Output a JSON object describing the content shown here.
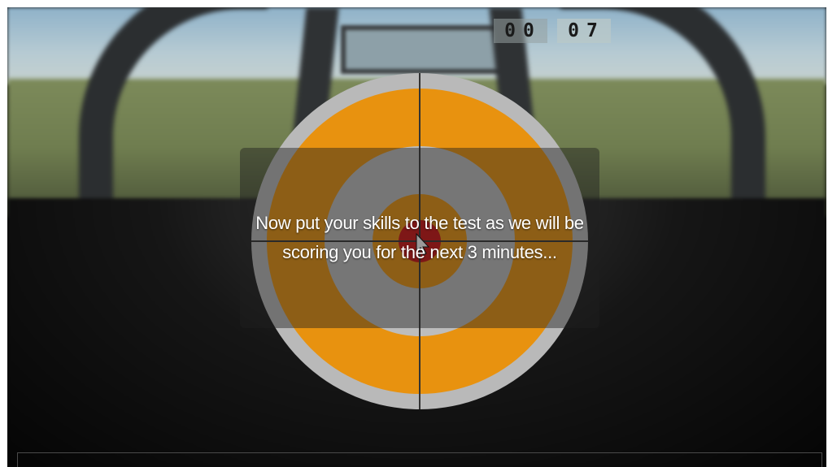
{
  "game": {
    "message": "Now put your skills to the test as we will be scoring you for the next 3 minutes...",
    "timer": {
      "minutes": "00",
      "seconds": "07"
    }
  },
  "colors": {
    "ring_orange": "#e8920f",
    "ring_grey": "#bdbdbd",
    "bullseye_red": "#cc1111",
    "crosshair": "#333333"
  },
  "icons": {
    "cursor": "cursor-arrow-icon"
  }
}
